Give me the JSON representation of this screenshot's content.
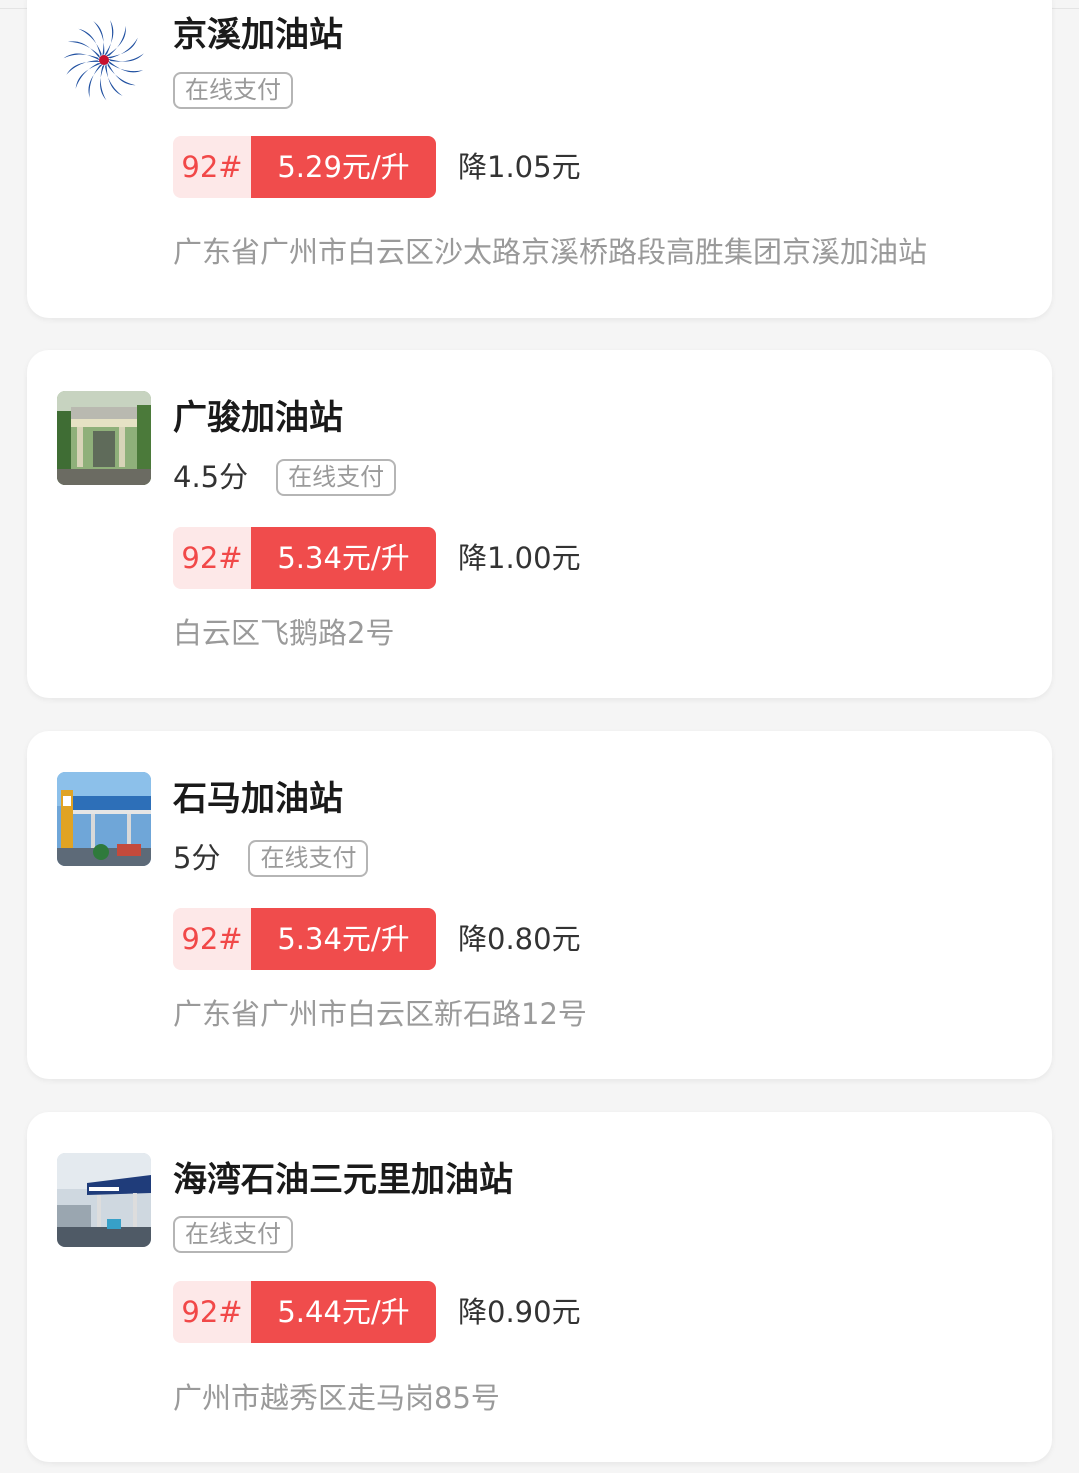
{
  "stations": [
    {
      "name": "京溪加油站",
      "rating": "",
      "tag": "在线支付",
      "grade": "92#",
      "price": "5.29元/升",
      "discount": "降1.05元",
      "address": "广东省广州市白云区沙太路京溪桥路段高胜集团京溪加油站",
      "thumb_icon": "spiral-logo-icon"
    },
    {
      "name": "广骏加油站",
      "rating": "4.5分",
      "tag": "在线支付",
      "grade": "92#",
      "price": "5.34元/升",
      "discount": "降1.00元",
      "address": "白云区飞鹅路2号",
      "thumb_icon": "station-photo"
    },
    {
      "name": "石马加油站",
      "rating": "5分",
      "tag": "在线支付",
      "grade": "92#",
      "price": "5.34元/升",
      "discount": "降0.80元",
      "address": "广东省广州市白云区新石路12号",
      "thumb_icon": "station-photo"
    },
    {
      "name": "海湾石油三元里加油站",
      "rating": "",
      "tag": "在线支付",
      "grade": "92#",
      "price": "5.44元/升",
      "discount": "降0.90元",
      "address": "广州市越秀区走马岗85号",
      "thumb_icon": "station-photo"
    }
  ],
  "colors": {
    "accent": "#f04c4c",
    "grade_bg": "#fde8e8",
    "grade_text": "#f14848",
    "page_bg": "#f5f5f5"
  }
}
